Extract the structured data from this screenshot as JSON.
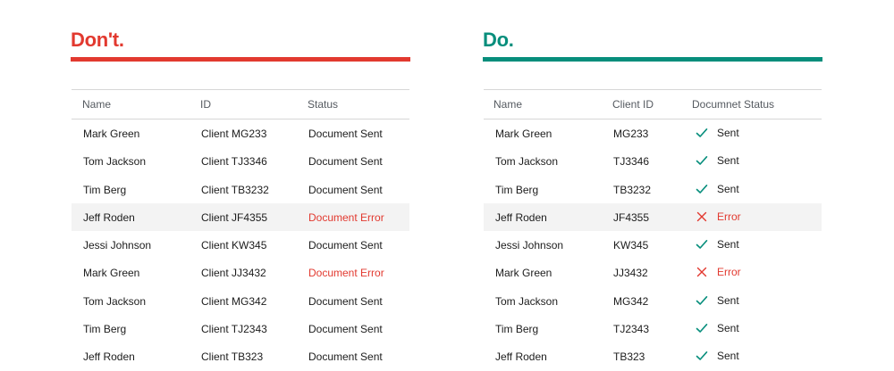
{
  "colors": {
    "dont": "#e2392f",
    "do": "#078e7c",
    "error": "#e2392f",
    "row_highlight": "#f3f3f3"
  },
  "dont": {
    "heading": "Don't.",
    "headers": {
      "name": "Name",
      "id": "ID",
      "status": "Status"
    },
    "rows": [
      {
        "name": "Mark Green",
        "id": "Client MG233",
        "status": "Document Sent"
      },
      {
        "name": "Tom Jackson",
        "id": "Client TJ3346",
        "status": "Document Sent"
      },
      {
        "name": "Tim Berg",
        "id": "Client TB3232",
        "status": "Document Sent"
      },
      {
        "name": "Jeff Roden",
        "id": "Client JF4355",
        "status": "Document Error"
      },
      {
        "name": "Jessi Johnson",
        "id": "Client KW345",
        "status": "Document Sent"
      },
      {
        "name": "Mark Green",
        "id": "Client JJ3432",
        "status": "Document Error"
      },
      {
        "name": "Tom Jackson",
        "id": "Client MG342",
        "status": "Document Sent"
      },
      {
        "name": "Tim Berg",
        "id": "Client TJ2343",
        "status": "Document Sent"
      },
      {
        "name": "Jeff Roden",
        "id": "Client TB323",
        "status": "Document Sent"
      }
    ]
  },
  "do": {
    "heading": "Do.",
    "headers": {
      "name": "Name",
      "id": "Client ID",
      "status": "Documnet Status"
    },
    "rows": [
      {
        "name": "Mark Green",
        "id": "MG233",
        "status": "Sent",
        "icon": "check-icon"
      },
      {
        "name": "Tom Jackson",
        "id": "TJ3346",
        "status": "Sent",
        "icon": "check-icon"
      },
      {
        "name": "Tim Berg",
        "id": "TB3232",
        "status": "Sent",
        "icon": "check-icon"
      },
      {
        "name": "Jeff Roden",
        "id": "JF4355",
        "status": "Error",
        "icon": "x-icon"
      },
      {
        "name": "Jessi Johnson",
        "id": "KW345",
        "status": "Sent",
        "icon": "check-icon"
      },
      {
        "name": "Mark Green",
        "id": "JJ3432",
        "status": "Error",
        "icon": "x-icon"
      },
      {
        "name": "Tom Jackson",
        "id": "MG342",
        "status": "Sent",
        "icon": "check-icon"
      },
      {
        "name": "Tim Berg",
        "id": "TJ2343",
        "status": "Sent",
        "icon": "check-icon"
      },
      {
        "name": "Jeff Roden",
        "id": "TB323",
        "status": "Sent",
        "icon": "check-icon"
      }
    ]
  }
}
